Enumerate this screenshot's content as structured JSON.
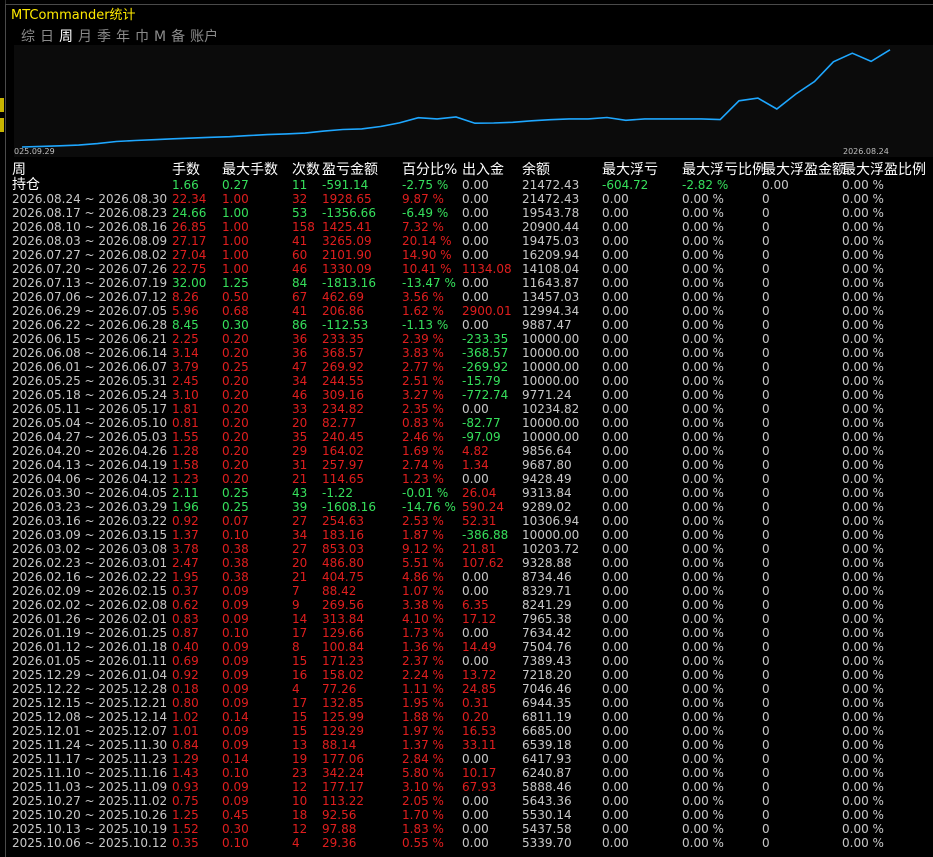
{
  "window": {
    "title": "MTCommander统计"
  },
  "tabs": [
    {
      "label": "综",
      "active": false
    },
    {
      "label": "日",
      "active": false
    },
    {
      "label": "周",
      "active": true
    },
    {
      "label": "月",
      "active": false
    },
    {
      "label": "季",
      "active": false
    },
    {
      "label": "年",
      "active": false
    },
    {
      "label": "巾",
      "active": false
    },
    {
      "label": "M",
      "active": false
    },
    {
      "label": "备",
      "active": false
    },
    {
      "label": "账户",
      "active": false
    }
  ],
  "chart_data": {
    "type": "line",
    "x_start_label": "025.09.29",
    "x_end_label": "2026.08.24",
    "series_color": "#1ea7ff",
    "values": [
      5339.7,
      5437.58,
      5530.14,
      5643.36,
      5888.46,
      6240.87,
      6417.93,
      6539.18,
      6685.0,
      6811.19,
      6944.35,
      7046.46,
      7218.2,
      7389.43,
      7504.76,
      7634.42,
      7965.38,
      8241.29,
      8329.71,
      8734.46,
      9328.88,
      10203.72,
      10000.0,
      10306.94,
      9289.02,
      9313.84,
      9428.49,
      9687.8,
      9856.64,
      10000.0,
      10000.0,
      10234.82,
      9771.24,
      10000.0,
      10000.0,
      10000.0,
      10000.0,
      9887.47,
      12994.34,
      13457.03,
      11643.87,
      14108.04,
      16209.94,
      19475.03,
      20900.44,
      19543.78,
      21472.43
    ],
    "y_range": [
      5000,
      21600
    ]
  },
  "table": {
    "headers": [
      "周",
      "手数",
      "最大手数",
      "次数",
      "盈亏金额",
      "百分比%",
      "出入金",
      "余额",
      "最大浮亏",
      "最大浮亏比例",
      "最大浮盈金额",
      "最大浮盈比例"
    ],
    "position_row": {
      "label": "持仓",
      "cells": [
        [
          "1.66",
          "pos"
        ],
        [
          "0.27",
          "pos"
        ],
        [
          "11",
          "pos"
        ],
        [
          "-591.14",
          "pos"
        ],
        [
          "-2.75 %",
          "pos"
        ],
        [
          "0.00",
          "neu"
        ],
        [
          "21472.43",
          "neu"
        ],
        [
          "-604.72",
          "pos"
        ],
        [
          "-2.82 %",
          "pos"
        ],
        [
          "0.00",
          "neu"
        ],
        [
          "0.00 %",
          "neu"
        ]
      ]
    },
    "rows": [
      {
        "period": "2026.08.24 ~ 2026.08.30",
        "cls": "neg",
        "lots": "22.34",
        "max_lots": "1.00",
        "count": "32",
        "pnl": "1928.65",
        "pct": "9.87 %",
        "flow": "0.00",
        "flow_cls": "neu",
        "balance": "21472.43"
      },
      {
        "period": "2026.08.17 ~ 2026.08.23",
        "cls": "pos",
        "lots": "24.66",
        "max_lots": "1.00",
        "count": "53",
        "pnl": "-1356.66",
        "pct": "-6.49 %",
        "flow": "0.00",
        "flow_cls": "neu",
        "balance": "19543.78"
      },
      {
        "period": "2026.08.10 ~ 2026.08.16",
        "cls": "neg",
        "lots": "26.85",
        "max_lots": "1.00",
        "count": "158",
        "pnl": "1425.41",
        "pct": "7.32 %",
        "flow": "0.00",
        "flow_cls": "neu",
        "balance": "20900.44"
      },
      {
        "period": "2026.08.03 ~ 2026.08.09",
        "cls": "neg",
        "lots": "27.17",
        "max_lots": "1.00",
        "count": "41",
        "pnl": "3265.09",
        "pct": "20.14 %",
        "flow": "0.00",
        "flow_cls": "neu",
        "balance": "19475.03"
      },
      {
        "period": "2026.07.27 ~ 2026.08.02",
        "cls": "neg",
        "lots": "27.04",
        "max_lots": "1.00",
        "count": "60",
        "pnl": "2101.90",
        "pct": "14.90 %",
        "flow": "0.00",
        "flow_cls": "neu",
        "balance": "16209.94"
      },
      {
        "period": "2026.07.20 ~ 2026.07.26",
        "cls": "neg",
        "lots": "22.75",
        "max_lots": "1.00",
        "count": "46",
        "pnl": "1330.09",
        "pct": "10.41 %",
        "flow": "1134.08",
        "flow_cls": "neg",
        "balance": "14108.04"
      },
      {
        "period": "2026.07.13 ~ 2026.07.19",
        "cls": "pos",
        "lots": "32.00",
        "max_lots": "1.25",
        "count": "84",
        "pnl": "-1813.16",
        "pct": "-13.47 %",
        "flow": "0.00",
        "flow_cls": "neu",
        "balance": "11643.87"
      },
      {
        "period": "2026.07.06 ~ 2026.07.12",
        "cls": "neg",
        "lots": "8.26",
        "max_lots": "0.50",
        "count": "67",
        "pnl": "462.69",
        "pct": "3.56 %",
        "flow": "0.00",
        "flow_cls": "neu",
        "balance": "13457.03"
      },
      {
        "period": "2026.06.29 ~ 2026.07.05",
        "cls": "neg",
        "lots": "5.96",
        "max_lots": "0.68",
        "count": "41",
        "pnl": "206.86",
        "pct": "1.62 %",
        "flow": "2900.01",
        "flow_cls": "neg",
        "balance": "12994.34"
      },
      {
        "period": "2026.06.22 ~ 2026.06.28",
        "cls": "pos",
        "lots": "8.45",
        "max_lots": "0.30",
        "count": "86",
        "pnl": "-112.53",
        "pct": "-1.13 %",
        "flow": "0.00",
        "flow_cls": "neu",
        "balance": "9887.47"
      },
      {
        "period": "2026.06.15 ~ 2026.06.21",
        "cls": "neg",
        "lots": "2.25",
        "max_lots": "0.20",
        "count": "36",
        "pnl": "233.35",
        "pct": "2.39 %",
        "flow": "-233.35",
        "flow_cls": "pos",
        "balance": "10000.00"
      },
      {
        "period": "2026.06.08 ~ 2026.06.14",
        "cls": "neg",
        "lots": "3.14",
        "max_lots": "0.20",
        "count": "36",
        "pnl": "368.57",
        "pct": "3.83 %",
        "flow": "-368.57",
        "flow_cls": "pos",
        "balance": "10000.00"
      },
      {
        "period": "2026.06.01 ~ 2026.06.07",
        "cls": "neg",
        "lots": "3.79",
        "max_lots": "0.25",
        "count": "47",
        "pnl": "269.92",
        "pct": "2.77 %",
        "flow": "-269.92",
        "flow_cls": "pos",
        "balance": "10000.00"
      },
      {
        "period": "2026.05.25 ~ 2026.05.31",
        "cls": "neg",
        "lots": "2.45",
        "max_lots": "0.20",
        "count": "34",
        "pnl": "244.55",
        "pct": "2.51 %",
        "flow": "-15.79",
        "flow_cls": "pos",
        "balance": "10000.00"
      },
      {
        "period": "2026.05.18 ~ 2026.05.24",
        "cls": "neg",
        "lots": "3.10",
        "max_lots": "0.20",
        "count": "46",
        "pnl": "309.16",
        "pct": "3.27 %",
        "flow": "-772.74",
        "flow_cls": "pos",
        "balance": "9771.24"
      },
      {
        "period": "2026.05.11 ~ 2026.05.17",
        "cls": "neg",
        "lots": "1.81",
        "max_lots": "0.20",
        "count": "33",
        "pnl": "234.82",
        "pct": "2.35 %",
        "flow": "0.00",
        "flow_cls": "neu",
        "balance": "10234.82"
      },
      {
        "period": "2026.05.04 ~ 2026.05.10",
        "cls": "neg",
        "lots": "0.81",
        "max_lots": "0.20",
        "count": "20",
        "pnl": "82.77",
        "pct": "0.83 %",
        "flow": "-82.77",
        "flow_cls": "pos",
        "balance": "10000.00"
      },
      {
        "period": "2026.04.27 ~ 2026.05.03",
        "cls": "neg",
        "lots": "1.55",
        "max_lots": "0.20",
        "count": "35",
        "pnl": "240.45",
        "pct": "2.46 %",
        "flow": "-97.09",
        "flow_cls": "pos",
        "balance": "10000.00"
      },
      {
        "period": "2026.04.20 ~ 2026.04.26",
        "cls": "neg",
        "lots": "1.28",
        "max_lots": "0.20",
        "count": "29",
        "pnl": "164.02",
        "pct": "1.69 %",
        "flow": "4.82",
        "flow_cls": "neg",
        "balance": "9856.64"
      },
      {
        "period": "2026.04.13 ~ 2026.04.19",
        "cls": "neg",
        "lots": "1.58",
        "max_lots": "0.20",
        "count": "31",
        "pnl": "257.97",
        "pct": "2.74 %",
        "flow": "1.34",
        "flow_cls": "neg",
        "balance": "9687.80"
      },
      {
        "period": "2026.04.06 ~ 2026.04.12",
        "cls": "neg",
        "lots": "1.23",
        "max_lots": "0.20",
        "count": "21",
        "pnl": "114.65",
        "pct": "1.23 %",
        "flow": "0.00",
        "flow_cls": "neu",
        "balance": "9428.49"
      },
      {
        "period": "2026.03.30 ~ 2026.04.05",
        "cls": "pos",
        "lots": "2.11",
        "max_lots": "0.25",
        "count": "43",
        "pnl": "-1.22",
        "pct": "-0.01 %",
        "flow": "26.04",
        "flow_cls": "neg",
        "balance": "9313.84"
      },
      {
        "period": "2026.03.23 ~ 2026.03.29",
        "cls": "pos",
        "lots": "1.96",
        "max_lots": "0.25",
        "count": "39",
        "pnl": "-1608.16",
        "pct": "-14.76 %",
        "flow": "590.24",
        "flow_cls": "neg",
        "balance": "9289.02"
      },
      {
        "period": "2026.03.16 ~ 2026.03.22",
        "cls": "neg",
        "lots": "0.92",
        "max_lots": "0.07",
        "count": "27",
        "pnl": "254.63",
        "pct": "2.53 %",
        "flow": "52.31",
        "flow_cls": "neg",
        "balance": "10306.94"
      },
      {
        "period": "2026.03.09 ~ 2026.03.15",
        "cls": "neg",
        "lots": "1.37",
        "max_lots": "0.10",
        "count": "34",
        "pnl": "183.16",
        "pct": "1.87 %",
        "flow": "-386.88",
        "flow_cls": "pos",
        "balance": "10000.00"
      },
      {
        "period": "2026.03.02 ~ 2026.03.08",
        "cls": "neg",
        "lots": "3.78",
        "max_lots": "0.38",
        "count": "27",
        "pnl": "853.03",
        "pct": "9.12 %",
        "flow": "21.81",
        "flow_cls": "neg",
        "balance": "10203.72"
      },
      {
        "period": "2026.02.23 ~ 2026.03.01",
        "cls": "neg",
        "lots": "2.47",
        "max_lots": "0.38",
        "count": "20",
        "pnl": "486.80",
        "pct": "5.51 %",
        "flow": "107.62",
        "flow_cls": "neg",
        "balance": "9328.88"
      },
      {
        "period": "2026.02.16 ~ 2026.02.22",
        "cls": "neg",
        "lots": "1.95",
        "max_lots": "0.38",
        "count": "21",
        "pnl": "404.75",
        "pct": "4.86 %",
        "flow": "0.00",
        "flow_cls": "neu",
        "balance": "8734.46"
      },
      {
        "period": "2026.02.09 ~ 2026.02.15",
        "cls": "neg",
        "lots": "0.37",
        "max_lots": "0.09",
        "count": "7",
        "pnl": "88.42",
        "pct": "1.07 %",
        "flow": "0.00",
        "flow_cls": "neu",
        "balance": "8329.71"
      },
      {
        "period": "2026.02.02 ~ 2026.02.08",
        "cls": "neg",
        "lots": "0.62",
        "max_lots": "0.09",
        "count": "9",
        "pnl": "269.56",
        "pct": "3.38 %",
        "flow": "6.35",
        "flow_cls": "neg",
        "balance": "8241.29"
      },
      {
        "period": "2026.01.26 ~ 2026.02.01",
        "cls": "neg",
        "lots": "0.83",
        "max_lots": "0.09",
        "count": "14",
        "pnl": "313.84",
        "pct": "4.10 %",
        "flow": "17.12",
        "flow_cls": "neg",
        "balance": "7965.38"
      },
      {
        "period": "2026.01.19 ~ 2026.01.25",
        "cls": "neg",
        "lots": "0.87",
        "max_lots": "0.10",
        "count": "17",
        "pnl": "129.66",
        "pct": "1.73 %",
        "flow": "0.00",
        "flow_cls": "neu",
        "balance": "7634.42"
      },
      {
        "period": "2026.01.12 ~ 2026.01.18",
        "cls": "neg",
        "lots": "0.40",
        "max_lots": "0.09",
        "count": "8",
        "pnl": "100.84",
        "pct": "1.36 %",
        "flow": "14.49",
        "flow_cls": "neg",
        "balance": "7504.76"
      },
      {
        "period": "2026.01.05 ~ 2026.01.11",
        "cls": "neg",
        "lots": "0.69",
        "max_lots": "0.09",
        "count": "15",
        "pnl": "171.23",
        "pct": "2.37 %",
        "flow": "0.00",
        "flow_cls": "neu",
        "balance": "7389.43"
      },
      {
        "period": "2025.12.29 ~ 2026.01.04",
        "cls": "neg",
        "lots": "0.92",
        "max_lots": "0.09",
        "count": "16",
        "pnl": "158.02",
        "pct": "2.24 %",
        "flow": "13.72",
        "flow_cls": "neg",
        "balance": "7218.20"
      },
      {
        "period": "2025.12.22 ~ 2025.12.28",
        "cls": "neg",
        "lots": "0.18",
        "max_lots": "0.09",
        "count": "4",
        "pnl": "77.26",
        "pct": "1.11 %",
        "flow": "24.85",
        "flow_cls": "neg",
        "balance": "7046.46"
      },
      {
        "period": "2025.12.15 ~ 2025.12.21",
        "cls": "neg",
        "lots": "0.80",
        "max_lots": "0.09",
        "count": "17",
        "pnl": "132.85",
        "pct": "1.95 %",
        "flow": "0.31",
        "flow_cls": "neg",
        "balance": "6944.35"
      },
      {
        "period": "2025.12.08 ~ 2025.12.14",
        "cls": "neg",
        "lots": "1.02",
        "max_lots": "0.14",
        "count": "15",
        "pnl": "125.99",
        "pct": "1.88 %",
        "flow": "0.20",
        "flow_cls": "neg",
        "balance": "6811.19"
      },
      {
        "period": "2025.12.01 ~ 2025.12.07",
        "cls": "neg",
        "lots": "1.01",
        "max_lots": "0.09",
        "count": "15",
        "pnl": "129.29",
        "pct": "1.97 %",
        "flow": "16.53",
        "flow_cls": "neg",
        "balance": "6685.00"
      },
      {
        "period": "2025.11.24 ~ 2025.11.30",
        "cls": "neg",
        "lots": "0.84",
        "max_lots": "0.09",
        "count": "13",
        "pnl": "88.14",
        "pct": "1.37 %",
        "flow": "33.11",
        "flow_cls": "neg",
        "balance": "6539.18"
      },
      {
        "period": "2025.11.17 ~ 2025.11.23",
        "cls": "neg",
        "lots": "1.29",
        "max_lots": "0.14",
        "count": "19",
        "pnl": "177.06",
        "pct": "2.84 %",
        "flow": "0.00",
        "flow_cls": "neu",
        "balance": "6417.93"
      },
      {
        "period": "2025.11.10 ~ 2025.11.16",
        "cls": "neg",
        "lots": "1.43",
        "max_lots": "0.10",
        "count": "23",
        "pnl": "342.24",
        "pct": "5.80 %",
        "flow": "10.17",
        "flow_cls": "neg",
        "balance": "6240.87"
      },
      {
        "period": "2025.11.03 ~ 2025.11.09",
        "cls": "neg",
        "lots": "0.93",
        "max_lots": "0.09",
        "count": "12",
        "pnl": "177.17",
        "pct": "3.10 %",
        "flow": "67.93",
        "flow_cls": "neg",
        "balance": "5888.46"
      },
      {
        "period": "2025.10.27 ~ 2025.11.02",
        "cls": "neg",
        "lots": "0.75",
        "max_lots": "0.09",
        "count": "10",
        "pnl": "113.22",
        "pct": "2.05 %",
        "flow": "0.00",
        "flow_cls": "neu",
        "balance": "5643.36"
      },
      {
        "period": "2025.10.20 ~ 2025.10.26",
        "cls": "neg",
        "lots": "1.25",
        "max_lots": "0.45",
        "count": "18",
        "pnl": "92.56",
        "pct": "1.70 %",
        "flow": "0.00",
        "flow_cls": "neu",
        "balance": "5530.14"
      },
      {
        "period": "2025.10.13 ~ 2025.10.19",
        "cls": "neg",
        "lots": "1.52",
        "max_lots": "0.30",
        "count": "12",
        "pnl": "97.88",
        "pct": "1.83 %",
        "flow": "0.00",
        "flow_cls": "neu",
        "balance": "5437.58"
      },
      {
        "period": "2025.10.06 ~ 2025.10.12",
        "cls": "neg",
        "lots": "0.35",
        "max_lots": "0.10",
        "count": "4",
        "pnl": "29.36",
        "pct": "0.55 %",
        "flow": "0.00",
        "flow_cls": "neu",
        "balance": "5339.70"
      }
    ],
    "zero_float": "0.00",
    "zero_pct": "0.00 %",
    "zero_int": "0"
  }
}
